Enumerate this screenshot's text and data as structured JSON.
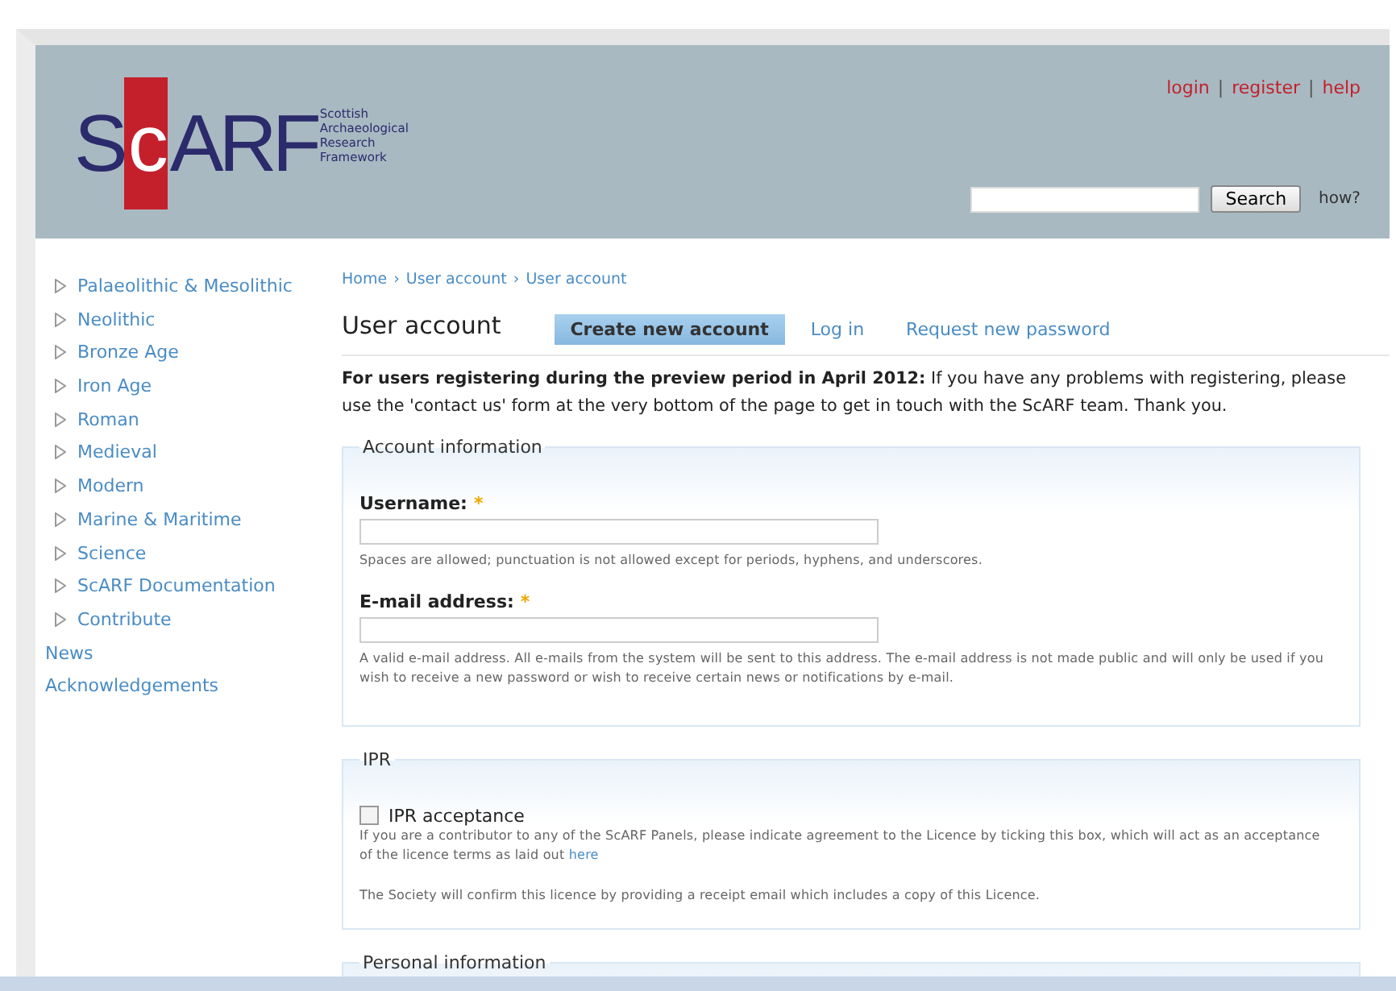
{
  "header": {
    "logo": {
      "prefix": "S",
      "highlight": "c",
      "rest": "ARF",
      "tagline": "Scottish Archaeological Research Framework"
    },
    "user_links": [
      {
        "label": "login"
      },
      {
        "separator": "|",
        "label": "register"
      },
      {
        "separator": "|",
        "label": "help"
      }
    ],
    "search": {
      "button": "Search",
      "help_link": "how?"
    }
  },
  "sidebar": {
    "items": [
      {
        "label": "Palaeolithic & Mesolithic",
        "kind": "expandable"
      },
      {
        "label": "Neolithic",
        "kind": "expandable"
      },
      {
        "label": "Bronze Age",
        "kind": "expandable"
      },
      {
        "label": "Iron Age",
        "kind": "expandable"
      },
      {
        "label": "Roman",
        "kind": "expandable"
      },
      {
        "label": "Medieval",
        "kind": "expandable"
      },
      {
        "label": "Modern",
        "kind": "expandable"
      },
      {
        "label": "Marine & Maritime",
        "kind": "expandable"
      },
      {
        "label": "Science",
        "kind": "expandable"
      },
      {
        "label": "ScARF Documentation",
        "kind": "expandable"
      },
      {
        "label": "Contribute",
        "kind": "expandable"
      },
      {
        "label": "News",
        "kind": "plain"
      },
      {
        "label": "Acknowledgements",
        "kind": "plain"
      }
    ]
  },
  "breadcrumb": [
    {
      "label": "Home"
    },
    {
      "separator": "›",
      "label": "User account"
    },
    {
      "separator": "›",
      "label": "User account"
    }
  ],
  "page_title": "User account",
  "tabs": [
    {
      "label": "Create new account",
      "selected": true
    },
    {
      "label": "Log in",
      "selected": false
    },
    {
      "label": "Request new password",
      "selected": false
    }
  ],
  "notice": "**For users registering during the preview period in April 2012:** If you have any problems with registering, please use the 'contact us' form at the very bottom of the page to get in touch with the ScARF team. Thank you.",
  "fieldsets": [
    {
      "legend": "Account information",
      "fields": [
        {
          "kind": "text",
          "label": "Username:",
          "required_mark": "*",
          "description": "Spaces are allowed; punctuation is not allowed except for periods, hyphens, and underscores."
        },
        {
          "kind": "text",
          "label": "E-mail address:",
          "required_mark": "*",
          "description": "A valid e-mail address. All e-mails from the system will be sent to this address. The e-mail address is not made public and will only be used if you wish to receive a new password or wish to receive certain news or notifications by e-mail."
        }
      ]
    },
    {
      "legend": "IPR",
      "fields": [
        {
          "kind": "checkbox",
          "label": "IPR acceptance",
          "checked": false,
          "description": "If you are a contributor to any of the ScARF Panels, please indicate agreement to the Licence by ticking this box, which will act as an acceptance of the licence terms as laid out",
          "link": "here",
          "note": "The Society will confirm this licence by providing a receipt email which includes a copy of this Licence."
        }
      ]
    },
    {
      "legend": "Personal information"
    }
  ]
}
